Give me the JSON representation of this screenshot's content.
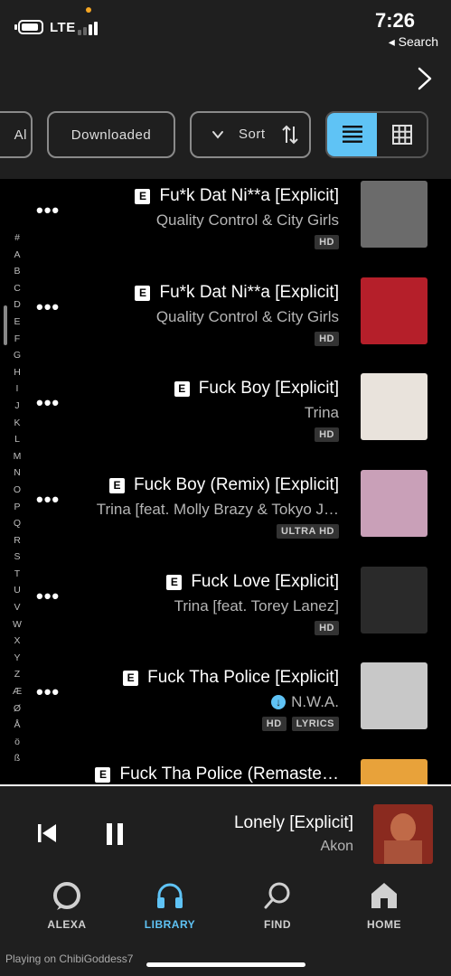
{
  "status_bar": {
    "time": "7:26",
    "back_label": "◂ Search",
    "network": "LTE"
  },
  "filters": {
    "partial_chip": "Al",
    "downloaded": "Downloaded",
    "sort": "Sort"
  },
  "alphabet": [
    "#",
    "A",
    "B",
    "C",
    "D",
    "E",
    "F",
    "G",
    "H",
    "I",
    "J",
    "K",
    "L",
    "M",
    "N",
    "O",
    "P",
    "Q",
    "R",
    "S",
    "T",
    "U",
    "V",
    "W",
    "X",
    "Y",
    "Z",
    "Æ",
    "Ø",
    "Å",
    "ö",
    "ß"
  ],
  "songs": [
    {
      "title": "Fu*k Dat Ni**a [Explicit]",
      "explicit": "E",
      "artist": "Quality Control & City Girls",
      "badges": [
        "HD"
      ],
      "downloaded": false,
      "art_color": "#6b6b6b"
    },
    {
      "title": "Fu*k Dat Ni**a [Explicit]",
      "explicit": "E",
      "artist": "Quality Control & City Girls",
      "badges": [
        "HD"
      ],
      "downloaded": false,
      "art_color": "#b51f2a"
    },
    {
      "title": "Fuck Boy [Explicit]",
      "explicit": "E",
      "artist": "Trina",
      "badges": [
        "HD"
      ],
      "downloaded": false,
      "art_color": "#e9e3dc"
    },
    {
      "title": "Fuck Boy (Remix) [Explicit]",
      "explicit": "E",
      "artist": "Trina [feat. Molly Brazy & Tokyo J…",
      "badges": [
        "ULTRA HD"
      ],
      "downloaded": false,
      "art_color": "#c9a0b8"
    },
    {
      "title": "Fuck Love [Explicit]",
      "explicit": "E",
      "artist": "Trina [feat. Torey Lanez]",
      "badges": [
        "HD"
      ],
      "downloaded": false,
      "art_color": "#2a2a2a"
    },
    {
      "title": "Fuck Tha Police [Explicit]",
      "explicit": "E",
      "artist": "N.W.A.",
      "badges": [
        "HD",
        "LYRICS"
      ],
      "downloaded": true,
      "art_color": "#c8c8c8"
    },
    {
      "title": "Fuck Tha Police (Remaste…",
      "explicit": "E",
      "artist": "",
      "badges": [],
      "downloaded": false,
      "art_color": "#e8a23a"
    }
  ],
  "now_playing": {
    "title": "Lonely [Explicit]",
    "artist": "Akon"
  },
  "tabs": {
    "alexa": "ALEXA",
    "library": "LIBRARY",
    "find": "FIND",
    "home": "HOME"
  },
  "casting_text": "Playing on ChibiGoddess7",
  "colors": {
    "accent": "#5fc3f5",
    "background": "#000000",
    "panel": "#1f1f1f"
  }
}
